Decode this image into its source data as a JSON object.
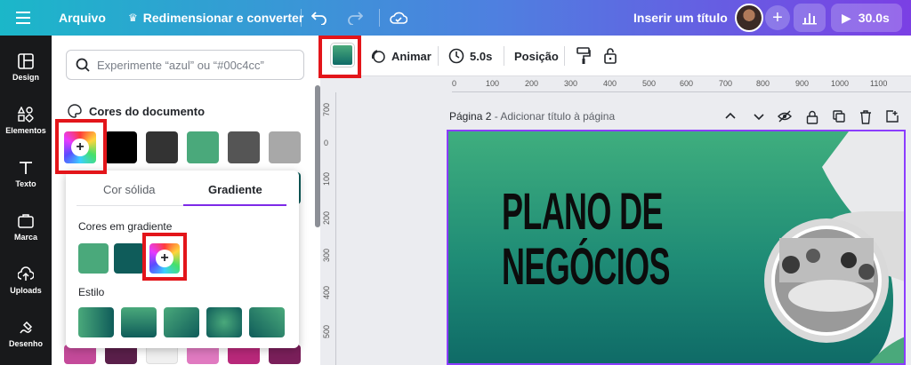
{
  "topbar": {
    "menu_icon": "hamburger-icon",
    "file_label": "Arquivo",
    "resize_label": "Redimensionar e converter",
    "title_placeholder": "Inserir um título",
    "play_duration": "30.0s"
  },
  "leftnav": {
    "items": [
      {
        "label": "Design",
        "icon": "layout-icon"
      },
      {
        "label": "Elementos",
        "icon": "shapes-icon"
      },
      {
        "label": "Texto",
        "icon": "text-icon"
      },
      {
        "label": "Marca",
        "icon": "brand-icon"
      },
      {
        "label": "Uploads",
        "icon": "upload-icon"
      },
      {
        "label": "Desenho",
        "icon": "draw-icon"
      }
    ]
  },
  "panel": {
    "search_placeholder": "Experimente “azul” ou “#00c4cc”",
    "doc_colors_title": "Cores do documento",
    "doc_colors": [
      "#000000",
      "#333333",
      "#4aa97b",
      "#555555",
      "#a8a8a8"
    ]
  },
  "popup": {
    "tab_solid": "Cor sólida",
    "tab_gradient": "Gradiente",
    "gradient_colors_title": "Cores em gradiente",
    "gradient_colors": [
      "#4aa97b",
      "#0f5c5a"
    ],
    "style_title": "Estilo"
  },
  "toolbar": {
    "animate_label": "Animar",
    "duration_label": "5.0s",
    "position_label": "Posição"
  },
  "ruler": {
    "top": [
      "0",
      "100",
      "200",
      "300",
      "400",
      "500",
      "600",
      "700",
      "800",
      "900",
      "1000",
      "1100"
    ],
    "left": [
      "700",
      "0",
      "100",
      "200",
      "300",
      "400",
      "500"
    ]
  },
  "page": {
    "label": "Página 2",
    "add_title": " - Adicionar título à página"
  },
  "canvas": {
    "headline_line1": "PLANO DE",
    "headline_line2": "NEGÓCIOS"
  },
  "colors": {
    "accent": "#7d2ae8",
    "highlight": "#e3151a"
  }
}
